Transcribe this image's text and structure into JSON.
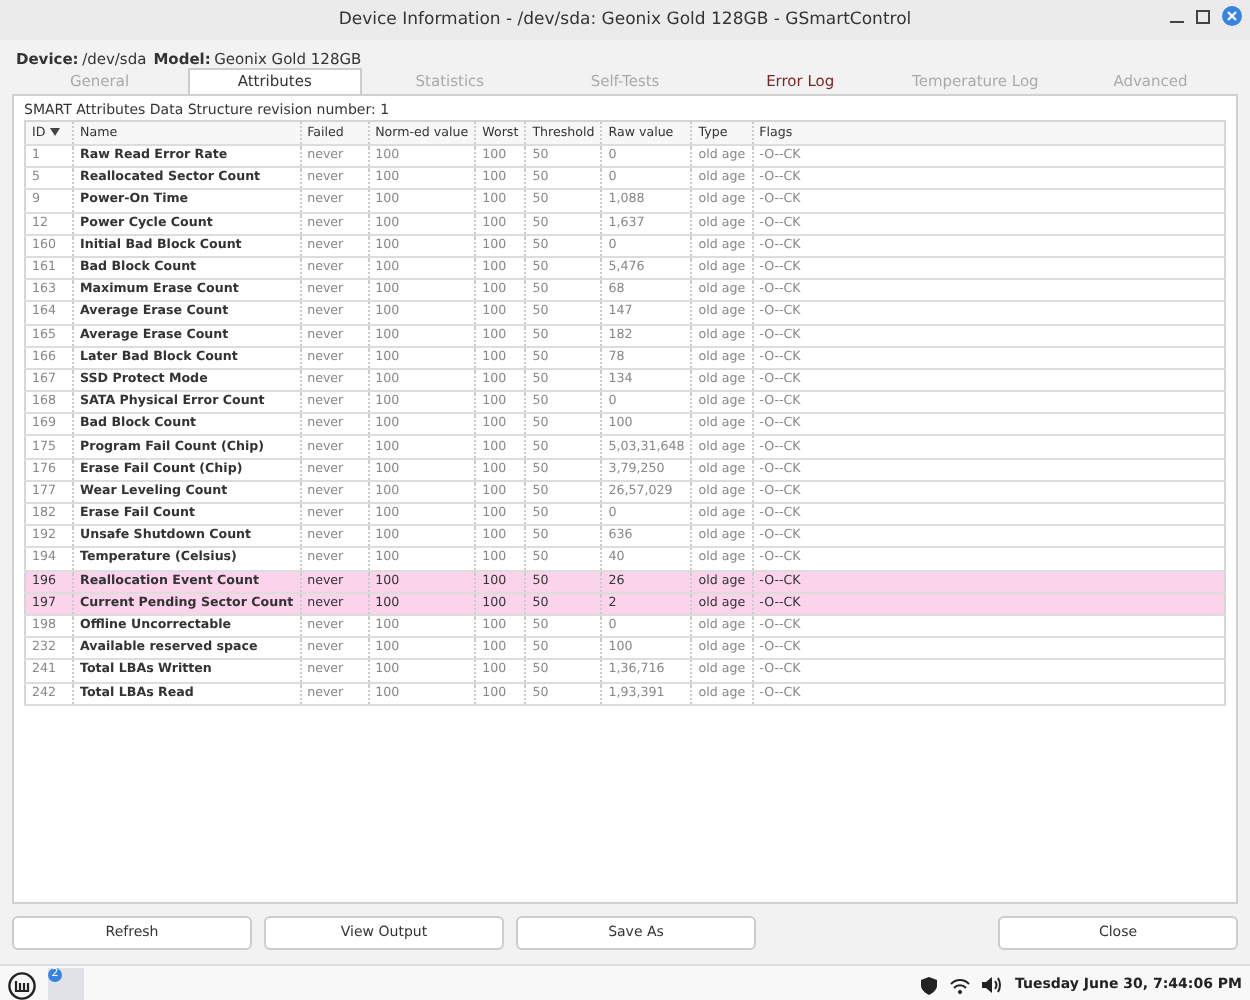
{
  "window": {
    "title": "Device Information - /dev/sda: Geonix Gold 128GB - GSmartControl"
  },
  "device": {
    "device_label": "Device:",
    "device": "/dev/sda",
    "model_label": "Model:",
    "model": "Geonix Gold 128GB"
  },
  "tabs": [
    {
      "label": "General",
      "selected": false,
      "warning": false
    },
    {
      "label": "Attributes",
      "selected": true,
      "warning": false
    },
    {
      "label": "Statistics",
      "selected": false,
      "warning": false
    },
    {
      "label": "Self-Tests",
      "selected": false,
      "warning": false
    },
    {
      "label": "Error Log",
      "selected": false,
      "warning": true
    },
    {
      "label": "Temperature Log",
      "selected": false,
      "warning": false
    },
    {
      "label": "Advanced",
      "selected": false,
      "warning": false
    }
  ],
  "revision": "SMART Attributes Data Structure revision number: 1",
  "table": {
    "columns": [
      "ID",
      "Name",
      "Failed",
      "Norm-ed value",
      "Worst",
      "Threshold",
      "Raw value",
      "Type",
      "Flags"
    ],
    "rows": [
      {
        "cells": [
          "1",
          "Raw Read Error Rate",
          "never",
          "100",
          "100",
          "50",
          "0",
          "old age",
          "-O--CK"
        ],
        "warning": false
      },
      {
        "cells": [
          "5",
          "Reallocated Sector Count",
          "never",
          "100",
          "100",
          "50",
          "0",
          "old age",
          "-O--CK"
        ],
        "warning": false
      },
      {
        "cells": [
          "9",
          "Power-On Time",
          "never",
          "100",
          "100",
          "50",
          "1,088",
          "old age",
          "-O--CK"
        ],
        "warning": false
      },
      {
        "cells": [
          "12",
          "Power Cycle Count",
          "never",
          "100",
          "100",
          "50",
          "1,637",
          "old age",
          "-O--CK"
        ],
        "warning": false
      },
      {
        "cells": [
          "160",
          "Initial Bad Block Count",
          "never",
          "100",
          "100",
          "50",
          "0",
          "old age",
          "-O--CK"
        ],
        "warning": false
      },
      {
        "cells": [
          "161",
          "Bad Block Count",
          "never",
          "100",
          "100",
          "50",
          "5,476",
          "old age",
          "-O--CK"
        ],
        "warning": false
      },
      {
        "cells": [
          "163",
          "Maximum Erase Count",
          "never",
          "100",
          "100",
          "50",
          "68",
          "old age",
          "-O--CK"
        ],
        "warning": false
      },
      {
        "cells": [
          "164",
          "Average Erase Count",
          "never",
          "100",
          "100",
          "50",
          "147",
          "old age",
          "-O--CK"
        ],
        "warning": false
      },
      {
        "cells": [
          "165",
          "Average Erase Count",
          "never",
          "100",
          "100",
          "50",
          "182",
          "old age",
          "-O--CK"
        ],
        "warning": false
      },
      {
        "cells": [
          "166",
          "Later Bad Block Count",
          "never",
          "100",
          "100",
          "50",
          "78",
          "old age",
          "-O--CK"
        ],
        "warning": false
      },
      {
        "cells": [
          "167",
          "SSD Protect Mode",
          "never",
          "100",
          "100",
          "50",
          "134",
          "old age",
          "-O--CK"
        ],
        "warning": false
      },
      {
        "cells": [
          "168",
          "SATA Physical Error Count",
          "never",
          "100",
          "100",
          "50",
          "0",
          "old age",
          "-O--CK"
        ],
        "warning": false
      },
      {
        "cells": [
          "169",
          "Bad Block Count",
          "never",
          "100",
          "100",
          "50",
          "100",
          "old age",
          "-O--CK"
        ],
        "warning": false
      },
      {
        "cells": [
          "175",
          "Program Fail Count (Chip)",
          "never",
          "100",
          "100",
          "50",
          "5,03,31,648",
          "old age",
          "-O--CK"
        ],
        "warning": false
      },
      {
        "cells": [
          "176",
          "Erase Fail Count (Chip)",
          "never",
          "100",
          "100",
          "50",
          "3,79,250",
          "old age",
          "-O--CK"
        ],
        "warning": false
      },
      {
        "cells": [
          "177",
          "Wear Leveling Count",
          "never",
          "100",
          "100",
          "50",
          "26,57,029",
          "old age",
          "-O--CK"
        ],
        "warning": false
      },
      {
        "cells": [
          "182",
          "Erase Fail Count",
          "never",
          "100",
          "100",
          "50",
          "0",
          "old age",
          "-O--CK"
        ],
        "warning": false
      },
      {
        "cells": [
          "192",
          "Unsafe Shutdown Count",
          "never",
          "100",
          "100",
          "50",
          "636",
          "old age",
          "-O--CK"
        ],
        "warning": false
      },
      {
        "cells": [
          "194",
          "Temperature (Celsius)",
          "never",
          "100",
          "100",
          "50",
          "40",
          "old age",
          "-O--CK"
        ],
        "warning": false
      },
      {
        "cells": [
          "196",
          "Reallocation Event Count",
          "never",
          "100",
          "100",
          "50",
          "26",
          "old age",
          "-O--CK"
        ],
        "warning": true
      },
      {
        "cells": [
          "197",
          "Current Pending Sector Count",
          "never",
          "100",
          "100",
          "50",
          "2",
          "old age",
          "-O--CK"
        ],
        "warning": true
      },
      {
        "cells": [
          "198",
          "Offline Uncorrectable",
          "never",
          "100",
          "100",
          "50",
          "0",
          "old age",
          "-O--CK"
        ],
        "warning": false
      },
      {
        "cells": [
          "232",
          "Available reserved space",
          "never",
          "100",
          "100",
          "50",
          "100",
          "old age",
          "-O--CK"
        ],
        "warning": false
      },
      {
        "cells": [
          "241",
          "Total LBAs Written",
          "never",
          "100",
          "100",
          "50",
          "1,36,716",
          "old age",
          "-O--CK"
        ],
        "warning": false
      },
      {
        "cells": [
          "242",
          "Total LBAs Read",
          "never",
          "100",
          "100",
          "50",
          "1,93,391",
          "old age",
          "-O--CK"
        ],
        "warning": false
      }
    ]
  },
  "buttons": [
    {
      "label": "Refresh"
    },
    {
      "label": "View Output"
    },
    {
      "label": "Save As"
    },
    {
      "label": "Close"
    }
  ],
  "taskbar": {
    "badge": "2",
    "clock": "Tuesday June 30, 7:44:06 PM"
  }
}
